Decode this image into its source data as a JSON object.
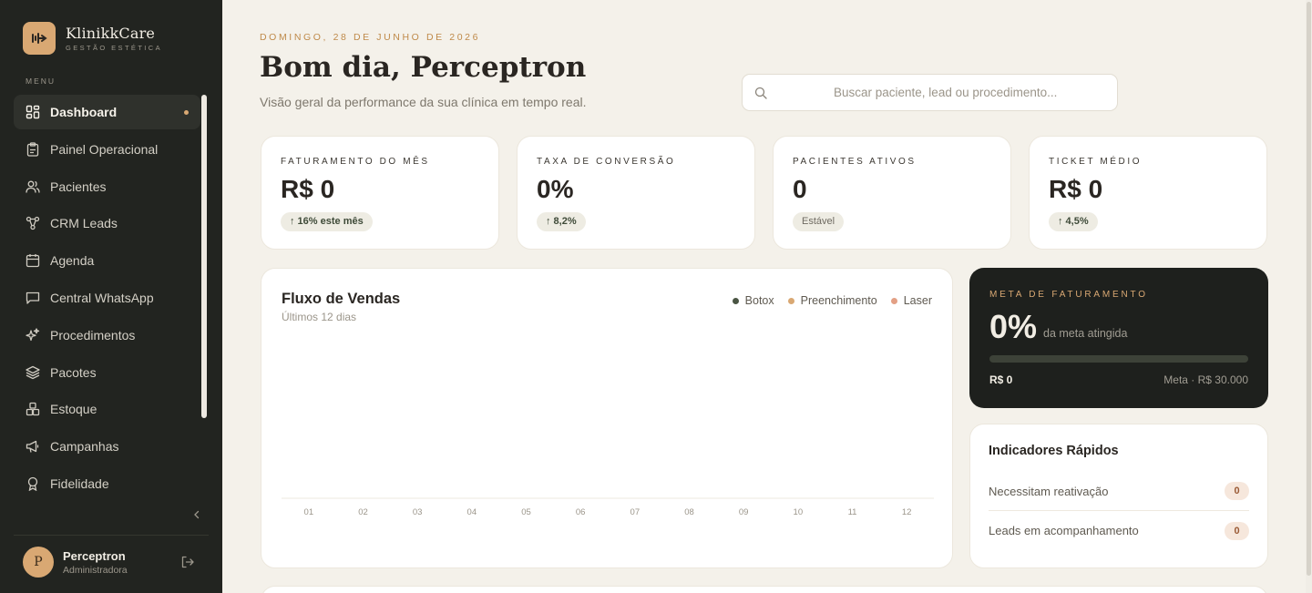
{
  "brand": {
    "name": "KlinikkCare",
    "subtitle": "GESTÃO ESTÉTICA"
  },
  "sidebar": {
    "menu_label": "MENU",
    "items": [
      {
        "label": "Dashboard",
        "icon": "dashboard-icon",
        "active": true
      },
      {
        "label": "Painel Operacional",
        "icon": "clipboard-icon"
      },
      {
        "label": "Pacientes",
        "icon": "users-icon"
      },
      {
        "label": "CRM Leads",
        "icon": "network-icon"
      },
      {
        "label": "Agenda",
        "icon": "calendar-icon"
      },
      {
        "label": "Central WhatsApp",
        "icon": "chat-icon"
      },
      {
        "label": "Procedimentos",
        "icon": "sparkles-icon"
      },
      {
        "label": "Pacotes",
        "icon": "layers-icon"
      },
      {
        "label": "Estoque",
        "icon": "boxes-icon"
      },
      {
        "label": "Campanhas",
        "icon": "megaphone-icon"
      },
      {
        "label": "Fidelidade",
        "icon": "award-icon"
      }
    ],
    "user": {
      "initial": "P",
      "name": "Perceptron",
      "role": "Administradora"
    }
  },
  "header": {
    "date": "DOMINGO, 28 DE JUNHO DE 2026",
    "greeting": "Bom dia, Perceptron",
    "subtitle": "Visão geral da performance da sua clínica em tempo real.",
    "search_placeholder": "Buscar paciente, lead ou procedimento..."
  },
  "kpis": [
    {
      "label": "FATURAMENTO DO MÊS",
      "value": "R$ 0",
      "badge": "↑ 16% este mês"
    },
    {
      "label": "TAXA DE CONVERSÃO",
      "value": "0%",
      "badge": "↑ 8,2%"
    },
    {
      "label": "PACIENTES ATIVOS",
      "value": "0",
      "badge": "Estável"
    },
    {
      "label": "TICKET MÉDIO",
      "value": "R$ 0",
      "badge": "↑ 4,5%"
    }
  ],
  "sales_flow": {
    "title": "Fluxo de Vendas",
    "subtitle": "Últimos 12 dias",
    "legend": [
      {
        "name": "Botox",
        "color": "#4a5543"
      },
      {
        "name": "Preenchimento",
        "color": "#d9a873"
      },
      {
        "name": "Laser",
        "color": "#e3a085"
      }
    ]
  },
  "chart_data": {
    "type": "area",
    "categories": [
      "01",
      "02",
      "03",
      "04",
      "05",
      "06",
      "07",
      "08",
      "09",
      "10",
      "11",
      "12"
    ],
    "series": [
      {
        "name": "Botox",
        "values": [
          0,
          0,
          0,
          0,
          0,
          0,
          0,
          0,
          0,
          0,
          0,
          0
        ]
      },
      {
        "name": "Preenchimento",
        "values": [
          0,
          0,
          0,
          0,
          0,
          0,
          0,
          0,
          0,
          0,
          0,
          0
        ]
      },
      {
        "name": "Laser",
        "values": [
          0,
          0,
          0,
          0,
          0,
          0,
          0,
          0,
          0,
          0,
          0,
          0
        ]
      }
    ],
    "title": "Fluxo de Vendas",
    "xlabel": "",
    "ylabel": "",
    "grid": false,
    "legend": "top-right"
  },
  "goal": {
    "label": "META DE FATURAMENTO",
    "value": "0%",
    "caption": "da meta atingida",
    "progress": 0,
    "current": "R$ 0",
    "target": "Meta · R$ 30.000"
  },
  "indicators": {
    "title": "Indicadores Rápidos",
    "rows": [
      {
        "label": "Necessitam reativação",
        "count": "0"
      },
      {
        "label": "Leads em acompanhamento",
        "count": "0"
      }
    ]
  },
  "colors": {
    "accent": "#d9a873",
    "sidebar_bg": "#222420",
    "page_bg": "#f4f1ea",
    "goal_bg": "#1e201d"
  }
}
